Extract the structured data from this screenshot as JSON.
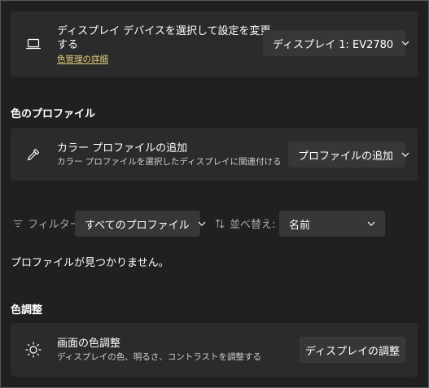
{
  "display_card": {
    "title_line1": "ディスプレイ デバイスを選択して設定を変更",
    "title_line2": "する",
    "link": "色管理の詳細",
    "selected_display": "ディスプレイ 1: EV2780",
    "icon": "laptop-icon"
  },
  "profile_section": {
    "heading": "色のプロファイル",
    "add_card": {
      "title": "カラー プロファイルの追加",
      "subtitle": "カラー プロファイルを選択したディスプレイに関連付ける",
      "button": "プロファイルの追加",
      "icon": "eyedropper-icon"
    },
    "filter": {
      "label": "フィルター:",
      "value": "すべてのプロファイル",
      "icon": "filter-icon"
    },
    "sort": {
      "label": "並べ替え:",
      "value": "名前",
      "icon": "sort-icon"
    },
    "empty_message": "プロファイルが見つかりません。"
  },
  "adjust_section": {
    "heading": "色調整",
    "card": {
      "title": "画面の色調整",
      "subtitle": "ディスプレイの色、明るさ、コントラストを調整する",
      "button": "ディスプレイの調整",
      "icon": "brightness-icon"
    }
  },
  "colors": {
    "background": "#202020",
    "card": "#2b2b2b",
    "control": "#373737",
    "link": "#e8d27a"
  }
}
